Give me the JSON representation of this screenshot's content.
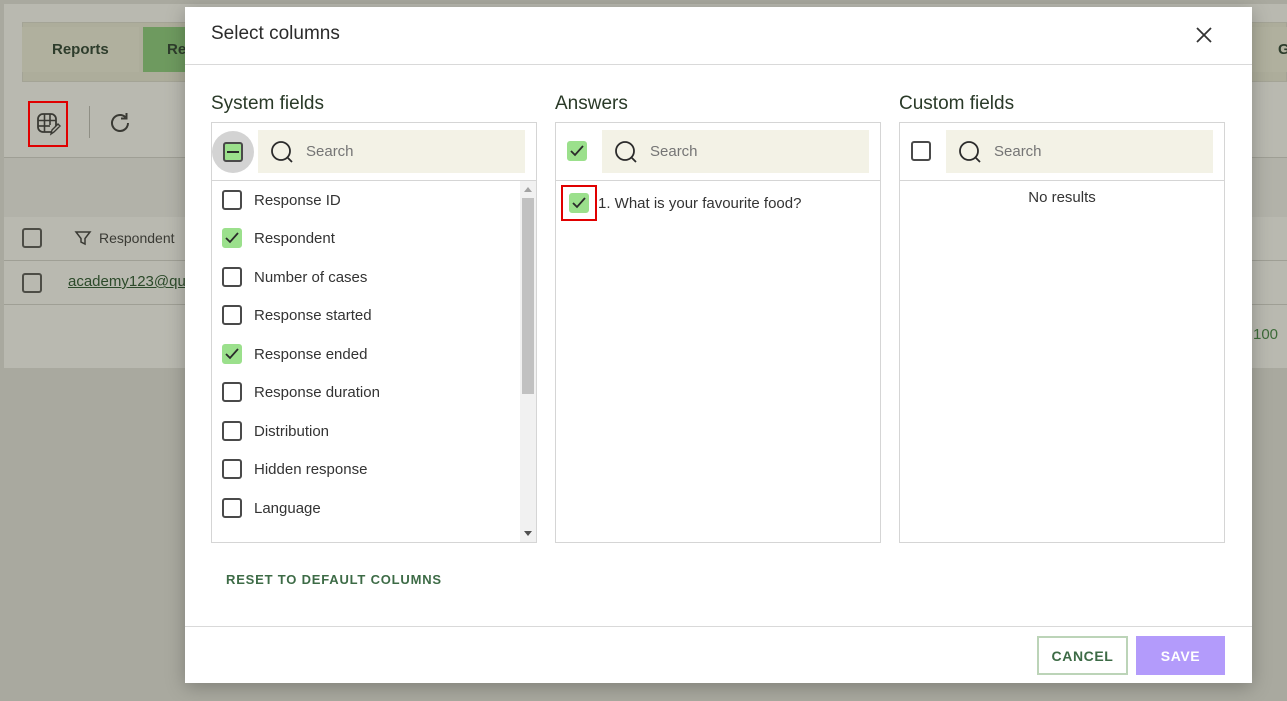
{
  "background": {
    "tabs": [
      {
        "label": "Reports"
      },
      {
        "label": "Re"
      },
      {
        "label": "G"
      }
    ],
    "table": {
      "column_header": "Respondent",
      "row_link": "academy123@qu"
    },
    "pagination_count": "100"
  },
  "modal": {
    "title": "Select columns",
    "system": {
      "title": "System fields",
      "search_placeholder": "Search",
      "items": [
        {
          "label": "Response ID",
          "checked": false
        },
        {
          "label": "Respondent",
          "checked": true
        },
        {
          "label": "Number of cases",
          "checked": false
        },
        {
          "label": "Response started",
          "checked": false
        },
        {
          "label": "Response ended",
          "checked": true
        },
        {
          "label": "Response duration",
          "checked": false
        },
        {
          "label": "Distribution",
          "checked": false
        },
        {
          "label": "Hidden response",
          "checked": false
        },
        {
          "label": "Language",
          "checked": false
        }
      ]
    },
    "answers": {
      "title": "Answers",
      "search_placeholder": "Search",
      "items": [
        {
          "label": "1. What is your favourite food?",
          "checked": true
        }
      ]
    },
    "custom": {
      "title": "Custom fields",
      "search_placeholder": "Search",
      "empty_text": "No results"
    },
    "reset_label": "RESET TO DEFAULT COLUMNS",
    "cancel_label": "CANCEL",
    "save_label": "SAVE"
  },
  "colors": {
    "accent_green": "#9be08c",
    "save_purple": "#b39bfb",
    "highlight_red": "#e00000"
  }
}
